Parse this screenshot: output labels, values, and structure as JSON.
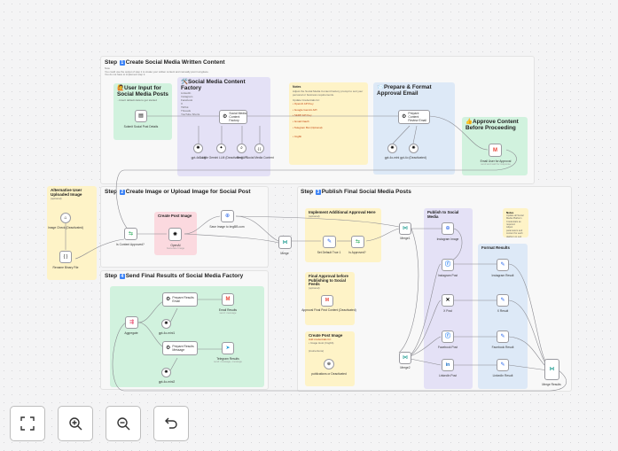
{
  "step1": {
    "title_pre": "Step ",
    "badge": "1",
    "title_post": "Create Social Media Written Content",
    "note_top": "Note",
    "note_line1": "You could use the output of step 1 to create your written content and manually post it anyplace.",
    "note_line2": "You do not have to implement step 2.",
    "user_input": {
      "title": "🙋User Input for Social Media Posts",
      "desc": "...Insert default data to get started",
      "node_label": "Submit Social Post Details"
    },
    "factory": {
      "title": "🛠️Social Media Content Factory",
      "platforms": [
        "LinkedIn",
        "Instagram",
        "Facebook",
        "X",
        "TikTok",
        "Threads",
        "YouTube Shorts"
      ],
      "node_label": "Social Media Content Factory",
      "tools": [
        {
          "label": "gpt-4o LLM"
        },
        {
          "label": "Google Gemini LLM (Deactivated)"
        },
        {
          "label": "SerpAPI"
        },
        {
          "label": "Social Media Content"
        }
      ]
    },
    "notes": {
      "title": "Notes",
      "intro": "Adjust the Social Media Content Factory prompt to suit your personal or business requirements.",
      "list_head": "Update Credentials for:",
      "items": [
        "OpenAI API Key",
        "Google Gemini API",
        "SERP API Key",
        "Gmail Oauth",
        "Telegram Bot (Optional)",
        "Imgbb"
      ]
    },
    "prepare": {
      "title": "📨Prepare & Format Approval Email",
      "node_label": "Prepare Content Review Email",
      "tools": [
        {
          "label": "gpt-4o-mini"
        },
        {
          "label": "gpt-4o (Deactivated)"
        }
      ]
    },
    "approve": {
      "title": "👍Approve Content Before Proceeding",
      "node_label": "Email User for Approval",
      "node_sub": "send and wait for response"
    }
  },
  "alt": {
    "title": "Alternative User Uploaded Image",
    "desc": "(optional)",
    "node1": "Image Check (Deactivated)",
    "node2": "Rename Binary File"
  },
  "step2": {
    "title_pre": "Step ",
    "badge": "2",
    "title_post": "Create Image or Upload Image for Social Post",
    "create_post_image": "Create Post Image",
    "is_content_approved": "Is Content Approved?",
    "openai": "OpenAI",
    "openai_sub": "Generate Image",
    "save_image": "Save Image to ImgBB.com",
    "merge": "Merge"
  },
  "step3": {
    "title_pre": "Step ",
    "badge": "3",
    "title_post": "Publish Final Social Media Posts",
    "impl": {
      "title": "Implement Additional Approval Here",
      "desc": "(optional)",
      "node1": "Set Default True 1",
      "node2": "Is Approved?"
    },
    "final": {
      "title": "Final Approval before Publishing to Social Feeds",
      "desc": "(optional)",
      "node": "Approval Final Post Content (Deactivated)"
    },
    "cpi": {
      "title": "Create Post Image",
      "desc1": "Add credentials for:",
      "desc2": "• Image Host (Imgbb)",
      "desc3": "(instructions)",
      "node": "publications or Deactivated"
    },
    "merge1": "Merge1",
    "merge2": "Merge2",
    "publish": {
      "title": "Publish to Social Media",
      "items": [
        "Instagram Image",
        "Instagram Post",
        "X Post",
        "Facebook Post",
        "LinkedIn Post"
      ]
    },
    "notes2": {
      "title": "Notes",
      "line1": "Update all Social Media Platform Credentials as required.",
      "line2": "Adjust parameters and content for each platform to suit your needs."
    },
    "format": {
      "title": "Format Results",
      "items": [
        "Instagram Result",
        "X Result",
        "Facebook Result",
        "LinkedIn Result"
      ]
    },
    "merge_results": "Merge Results"
  },
  "step4": {
    "title_pre": "Step ",
    "badge": "4",
    "title_post": "Send Final Results of Social Media Factory",
    "aggregate": "Aggregate",
    "email": "Prepare Results Email",
    "message": "Prepare Results Message",
    "gmini1": "gpt-4o-mini1",
    "gmini2": "gpt-4o-mini2",
    "email_results": "Email Results",
    "email_sub": "send: message",
    "telegram": "Telegram Results",
    "telegram_sub": "send: message, message"
  },
  "controls": {
    "fit_icon": "fit-view-icon",
    "zoom_in_icon": "zoom-in-icon",
    "zoom_out_icon": "zoom-out-icon",
    "reset_icon": "reset-zoom-icon"
  },
  "colors": {
    "yellow": "#fef3c7",
    "green": "#d1f2de",
    "purple": "#e4e1f6",
    "blue": "#dde9f7",
    "pink": "#fbd9df",
    "accent": "#3b82f6"
  }
}
